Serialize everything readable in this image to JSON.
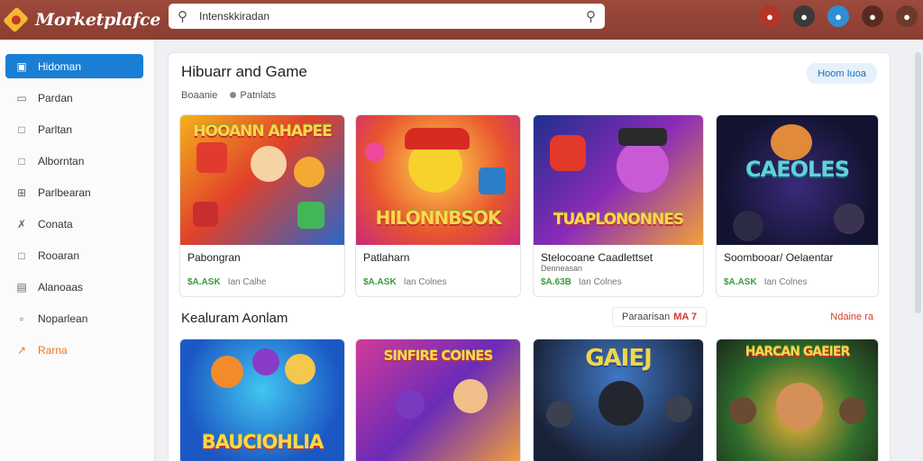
{
  "app": {
    "title": "Morketplafce"
  },
  "search": {
    "value": "Intenskkiradan"
  },
  "sidebar": {
    "items": [
      {
        "label": "Hidoman",
        "icon": "square-icon"
      },
      {
        "label": "Pardan",
        "icon": "card-icon"
      },
      {
        "label": "Parltan",
        "icon": "document-icon"
      },
      {
        "label": "Alborntan",
        "icon": "folder-icon"
      },
      {
        "label": "Parlbearan",
        "icon": "grid-icon"
      },
      {
        "label": "Conata",
        "icon": "tools-icon"
      },
      {
        "label": "Rooaran",
        "icon": "note-icon"
      },
      {
        "label": "Alanoaas",
        "icon": "list-icon"
      },
      {
        "label": "Noparlean",
        "icon": "chat-icon"
      },
      {
        "label": "Rarna",
        "icon": "trend-icon"
      }
    ]
  },
  "section1": {
    "title": "Hibuarr and Game",
    "button": "Hoom Iuoa",
    "filters": [
      "Boaanie",
      "Patnlats"
    ]
  },
  "section2": {
    "title": "Kealuram Aonlam",
    "tag_label": "Paraarisan",
    "tag_value": "MA 7",
    "link": "Ndaine ra"
  },
  "cards_row1": [
    {
      "title": "HOOANN AHAPEE",
      "name": "Pabongran",
      "sub": "",
      "price": "$A.ASK",
      "meta": "Ian Calhe"
    },
    {
      "title": "HILONNBSOK",
      "name": "Patlaharn",
      "sub": "",
      "price": "$A.ASK",
      "meta": "Ian Colnes"
    },
    {
      "title": "TUAPLONONNES",
      "name": "Stelocoane Caadlettset",
      "sub": "Denneasan",
      "price": "$A.63B",
      "meta": "Ian Colnes"
    },
    {
      "title": "CAEOLES",
      "name": "Soombooar/ Oelaentar",
      "sub": "",
      "price": "$A.ASK",
      "meta": "Ian Colnes"
    }
  ],
  "cards_row2": [
    {
      "title": "BAUCIOHLIA"
    },
    {
      "title": "SINFIRE COINES"
    },
    {
      "title": "GAIEJ"
    },
    {
      "title": "HARCAN GAEIER"
    }
  ],
  "colors": {
    "topbar": "#8b3e31",
    "accent": "#1a7fd4",
    "price": "#3a9a3a"
  }
}
